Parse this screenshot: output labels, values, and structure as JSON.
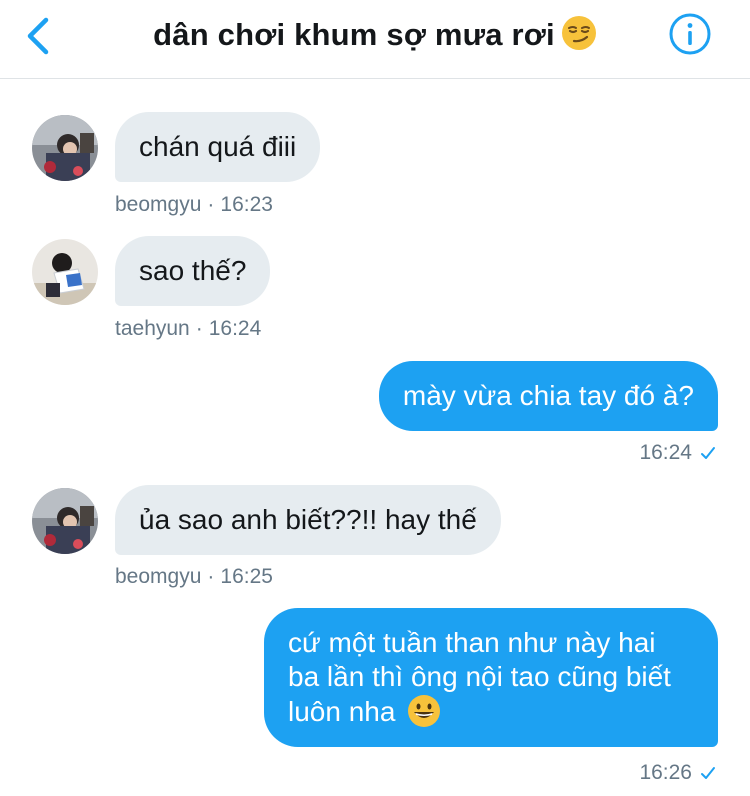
{
  "header": {
    "title": "dân chơi khum sợ mưa rơi",
    "title_emoji": "smirking-face",
    "back_icon": "chevron-left-icon",
    "info_icon": "info-icon",
    "accent": "#1da1f2"
  },
  "messages": [
    {
      "dir": "in",
      "text": "chán quá điii",
      "sender": "beomgyu",
      "time": "16:23"
    },
    {
      "dir": "in",
      "text": "sao thế?",
      "sender": "taehyun",
      "time": "16:24"
    },
    {
      "dir": "out",
      "text": "mày vừa chia tay đó à?",
      "time": "16:24"
    },
    {
      "dir": "in",
      "text": "ủa sao anh biết??!! hay thế",
      "sender": "beomgyu",
      "time": "16:25"
    },
    {
      "dir": "out",
      "text": "cứ một tuần than như này hai ba lần thì ông nội tao cũng biết luôn nha",
      "emoji": "grinning-face",
      "time": "16:26"
    }
  ],
  "separator": "·",
  "colors": {
    "incoming_bubble": "#e6ecf0",
    "outgoing_bubble": "#1da1f2",
    "meta_text": "#657786"
  }
}
